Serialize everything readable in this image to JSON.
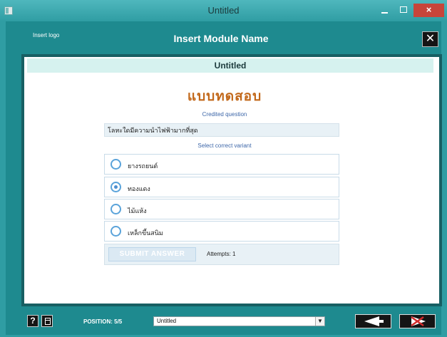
{
  "window": {
    "title": "Untitled",
    "close_glyph": "×"
  },
  "header": {
    "logo_text": "Insert logo",
    "module_name": "Insert Module Name",
    "close_glyph": "✕"
  },
  "page": {
    "heading": "Untitled"
  },
  "quiz": {
    "title": "แบบทดสอบ",
    "question_label": "Credited question",
    "question": "โลหะใดมีความนำไฟฟ้ามากที่สุด",
    "variant_label": "Select correct variant",
    "options": [
      {
        "label": "ยางรถยนต์",
        "selected": false
      },
      {
        "label": "ทองแดง",
        "selected": true
      },
      {
        "label": "ไม้แห้ง",
        "selected": false
      },
      {
        "label": "เหล็กขึ้นสนิม",
        "selected": false
      }
    ],
    "submit_label": "SUBMIT ANSWER",
    "attempts_text": "Attempts: 1"
  },
  "footer": {
    "help_glyph": "?",
    "position_text": "POSITION: 5/5",
    "select_value": "Untitled",
    "select_arrow": "▼"
  },
  "colors": {
    "frame": "#1e8a8f",
    "title_accent": "#c2681a",
    "label_blue": "#3c66a8",
    "radio_blue": "#5aa3da",
    "next_disabled_x": "#d12b2b"
  },
  "icons": {
    "help": "help-icon",
    "list": "list-icon",
    "prev": "arrow-left-icon",
    "next": "arrow-right-disabled-icon",
    "close": "close-icon"
  }
}
